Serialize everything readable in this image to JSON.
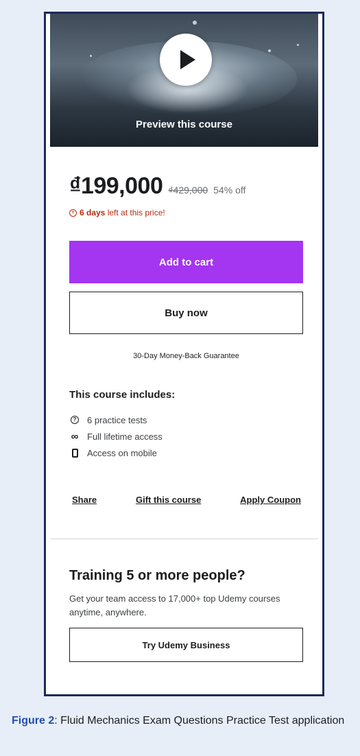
{
  "preview": {
    "label": "Preview this course",
    "play_icon": "play-icon"
  },
  "pricing": {
    "price": "₫199,000",
    "original_price": "₫429,000",
    "discount": "54% off",
    "timer_icon": "alarm-clock-icon",
    "timer_bold": "6 days",
    "timer_rest": " left at this price!"
  },
  "buttons": {
    "add_to_cart": "Add to cart",
    "buy_now": "Buy now"
  },
  "guarantee": "30-Day Money-Back Guarantee",
  "includes": {
    "title": "This course includes:",
    "items": [
      {
        "icon": "question-circle-icon",
        "label": "6 practice tests"
      },
      {
        "icon": "infinity-icon",
        "label": "Full lifetime access"
      },
      {
        "icon": "mobile-icon",
        "label": "Access on mobile"
      }
    ]
  },
  "links": {
    "share": "Share",
    "gift": "Gift this course",
    "coupon": "Apply Coupon"
  },
  "business": {
    "title": "Training 5 or more people?",
    "description": "Get your team access to 17,000+ top Udemy courses anytime, anywhere.",
    "button": "Try Udemy Business"
  },
  "caption": {
    "label": "Figure 2",
    "text": ": Fluid Mechanics Exam Questions Practice Test application"
  },
  "colors": {
    "accent": "#a435f0",
    "timer": "#b32d0f",
    "caption_label": "#1f4fb4",
    "frame_border": "#1d2a5c"
  }
}
